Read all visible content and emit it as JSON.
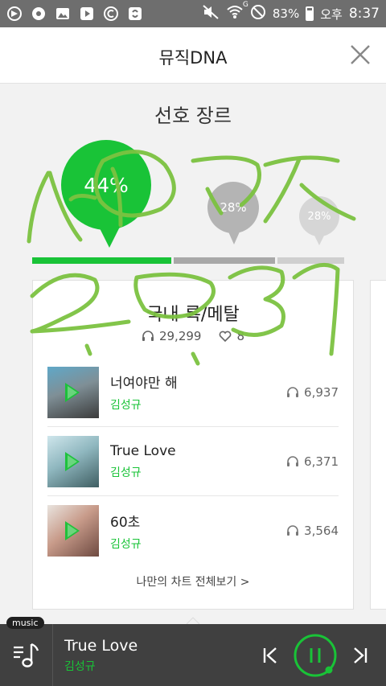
{
  "status_bar": {
    "battery_percent": "83%",
    "ampm": "오후",
    "time": "8:37",
    "wifi_badge": "G"
  },
  "header": {
    "title": "뮤직DNA"
  },
  "genre_section": {
    "title": "선호 장르",
    "bubbles": [
      {
        "percent": "44%",
        "color": "#19c337"
      },
      {
        "percent": "28%",
        "color": "#b4b4b4"
      },
      {
        "percent": "28%",
        "color": "#d6d6d6"
      }
    ],
    "bar": [
      {
        "fraction": 0.44,
        "color": "#19c337"
      },
      {
        "fraction": 0.32,
        "color": "#a8a8a8"
      },
      {
        "fraction": 0.21,
        "color": "#cfcfcf"
      }
    ]
  },
  "card": {
    "genre_name": "국내 록/메탈",
    "listen_count": "29,299",
    "like_count": "8",
    "tracks": [
      {
        "title": "너여야만 해",
        "artist": "김성규",
        "plays": "6,937"
      },
      {
        "title": "True Love",
        "artist": "김성규",
        "plays": "6,371"
      },
      {
        "title": "60초",
        "artist": "김성규",
        "plays": "3,564"
      }
    ],
    "chart_link": "나만의 차트 전체보기 >"
  },
  "player": {
    "badge": "music",
    "now_title": "True Love",
    "now_artist": "김성규",
    "accent": "#19c337"
  }
}
